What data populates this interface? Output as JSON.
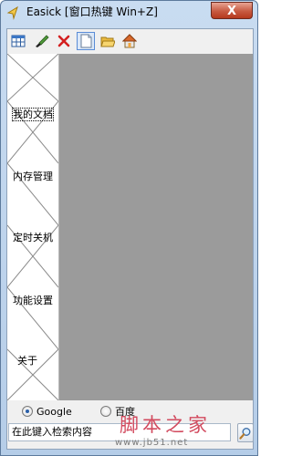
{
  "window": {
    "title": "Easick [窗口热键 Win+Z]",
    "close_label": "X"
  },
  "toolbar": {
    "items": [
      {
        "name": "grid-icon"
      },
      {
        "name": "brush-icon"
      },
      {
        "name": "delete-icon"
      },
      {
        "name": "note-icon"
      },
      {
        "name": "folder-icon"
      },
      {
        "name": "home-icon"
      }
    ]
  },
  "sidebar": {
    "items": [
      {
        "label": "我的文档",
        "selected": true
      },
      {
        "label": "内存管理"
      },
      {
        "label": "定时关机"
      },
      {
        "label": "功能设置"
      },
      {
        "label": "关于"
      }
    ]
  },
  "search": {
    "engines": [
      {
        "label": "Google",
        "checked": true
      },
      {
        "label": "百度",
        "checked": false
      }
    ],
    "placeholder": "在此键入检索内容"
  },
  "watermark": {
    "text": "脚本之家",
    "url": "www.jb51.net"
  },
  "colors": {
    "panel_gray": "#9b9b9b",
    "title_bar": "#c9dcf1",
    "close_red": "#c75a41",
    "watermark_red": "#d24a5e"
  }
}
